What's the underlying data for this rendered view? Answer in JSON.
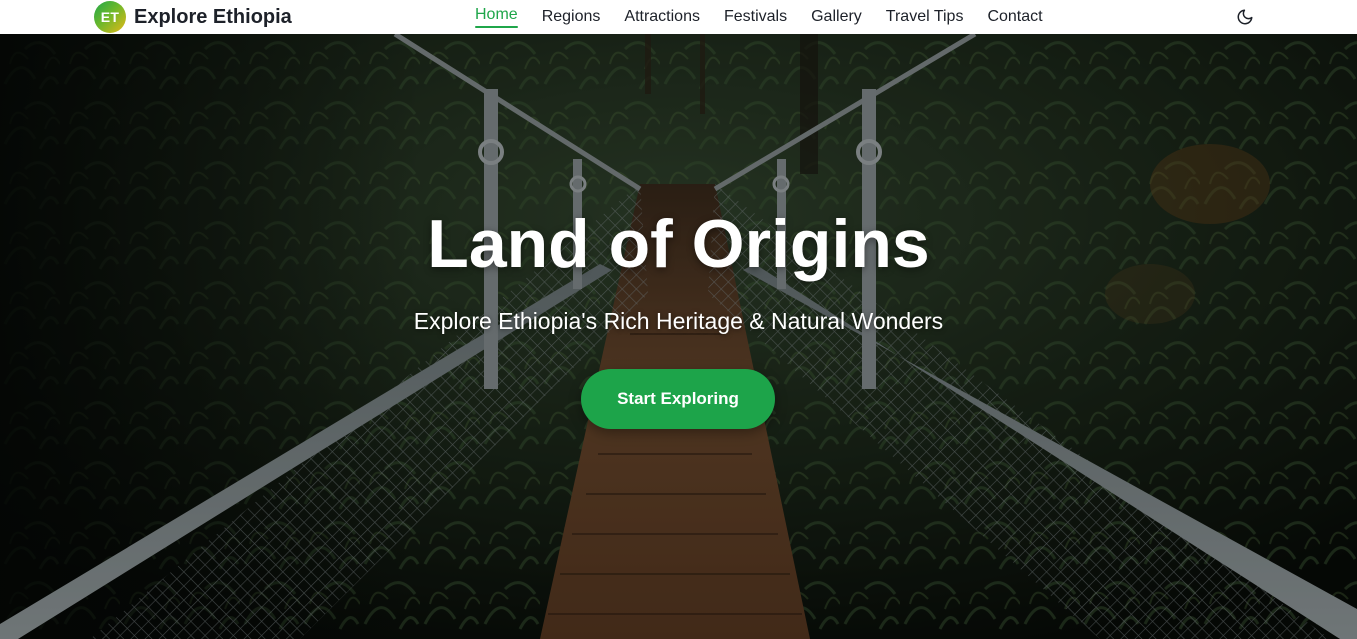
{
  "brand": {
    "logo_text": "ET",
    "name": "Explore Ethiopia"
  },
  "nav": {
    "items": [
      {
        "label": "Home",
        "active": true
      },
      {
        "label": "Regions",
        "active": false
      },
      {
        "label": "Attractions",
        "active": false
      },
      {
        "label": "Festivals",
        "active": false
      },
      {
        "label": "Gallery",
        "active": false
      },
      {
        "label": "Travel Tips",
        "active": false
      },
      {
        "label": "Contact",
        "active": false
      }
    ],
    "theme_toggle_icon": "moon-icon"
  },
  "hero": {
    "title": "Land of Origins",
    "subtitle": "Explore Ethiopia's Rich Heritage & Natural Wonders",
    "cta_label": "Start Exploring",
    "background": "forest suspension bridge photo"
  },
  "colors": {
    "accent": "#1fa64a",
    "nav_text": "#1d2129",
    "nav_background": "#ffffff",
    "hero_text": "#ffffff"
  }
}
